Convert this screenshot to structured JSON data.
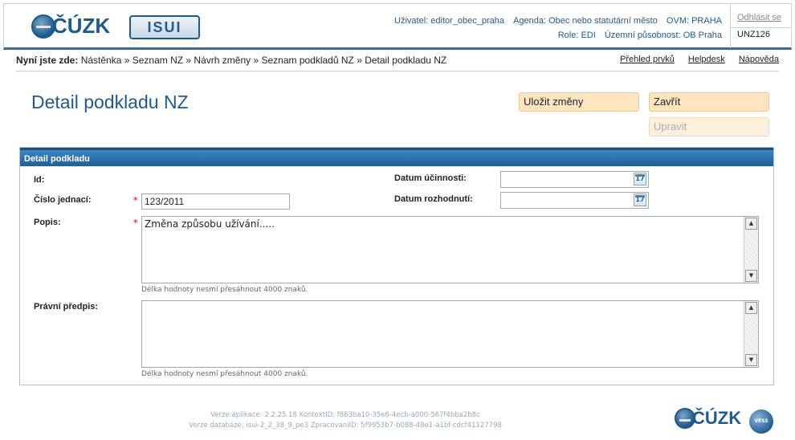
{
  "header": {
    "logo_text": "ČÚZK",
    "app_logo": "ISUI",
    "user_line1": [
      "Uživatel: editor_obec_praha",
      "Agenda: Obec nebo statutární město",
      "OVM: PRAHA"
    ],
    "user_line2": [
      "Role: EDI",
      "Územní působnost: OB Praha"
    ],
    "logout": "Odhlásit se",
    "unz": "UNZ126"
  },
  "breadcrumb": {
    "label": "Nyní jste zde:",
    "path": "Nástěnka » Seznam NZ » Návrh změny » Seznam podkladů NZ » Detail podkladu NZ",
    "links": [
      "Přehled prvků",
      "Helpdesk",
      "Nápověda"
    ]
  },
  "page": {
    "title": "Detail podkladu NZ",
    "buttons": {
      "save": "Uložit změny",
      "close": "Zavřít",
      "edit": "Upravit"
    }
  },
  "form": {
    "panel_title": "Detail podkladu",
    "labels": {
      "id": "Id:",
      "cislo": "Číslo jednací:",
      "popis": "Popis:",
      "predpis": "Právní předpis:",
      "datum_ucinnosti": "Datum účinnosti:",
      "datum_rozhodnuti": "Datum rozhodnutí:"
    },
    "required_mark": "*",
    "values": {
      "cislo": "123/2011",
      "popis": "Změna způsobu užívání.....",
      "predpis": "",
      "datum_ucinnosti": "",
      "datum_rozhodnuti": ""
    },
    "calendar_icon_text": "17",
    "hint": "Délka hodnoty nesmí přesáhnout 4000 znaků."
  },
  "footer": {
    "line1": "Verze aplikace: 2.2.25.18 KontextID: f863ba10-35e6-4ecb-a000-567f4bba2b8c",
    "line2": "Verze databáze: isui-2_2_38_9_pe3 ZpracovaniID: 5f9953b7-b088-48e1-a1bf-cdcf41127798",
    "logo_text": "ČÚZK",
    "vess_logo": "VESS"
  },
  "icons": [
    "globe-icon",
    "calendar-icon",
    "scroll-up-icon",
    "scroll-down-icon"
  ],
  "colors": {
    "brand": "#1f5a8c",
    "button_bg": "#fde6bf",
    "panel_head": "#2b6ea3"
  }
}
